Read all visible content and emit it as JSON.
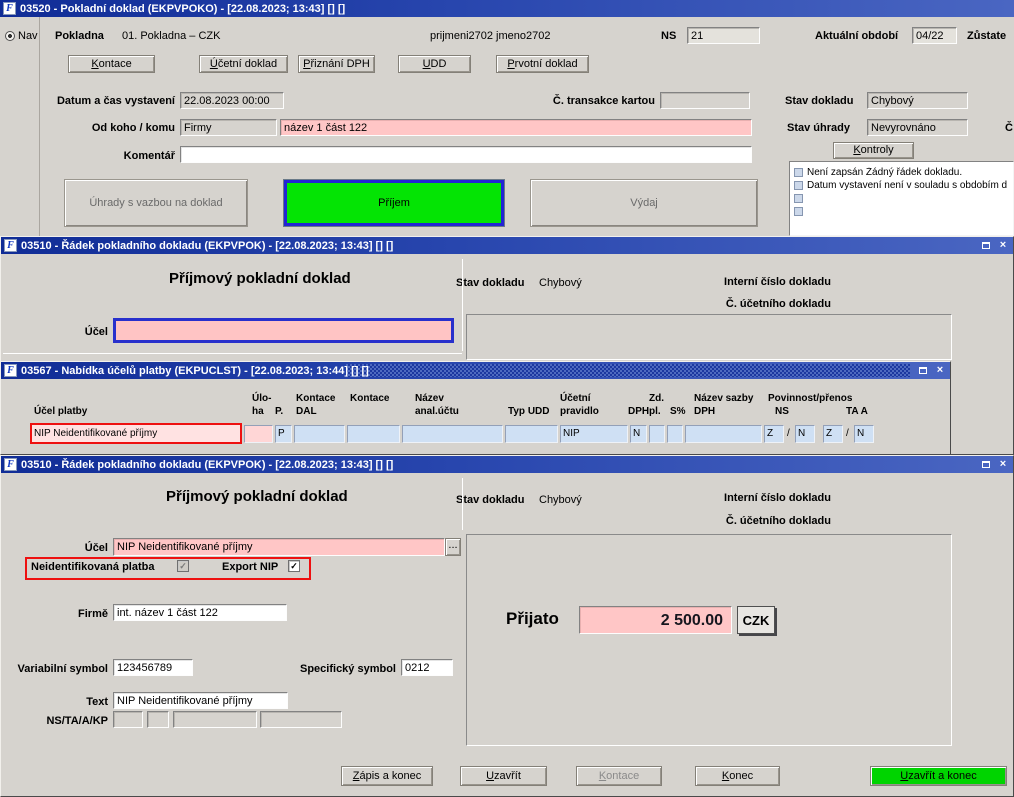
{
  "app": {
    "icon_letter": "F",
    "close_glyph": "×"
  },
  "w1": {
    "title": "03520 - Pokladní doklad (EKPVPOKO) - [22.08.2023; 13:43]  []  []",
    "nav_label": "Nav",
    "pokladna_label": "Pokladna",
    "pokladna_value": "01. Pokladna – CZK",
    "user_text": "prijmeni2702 jmeno2702",
    "ns_label": "NS",
    "ns_value": "21",
    "obdobi_label": "Aktuální období",
    "obdobi_value": "04/22",
    "zustatek_label": "Zůstate",
    "btn_kontace_u": "K",
    "btn_kontace_rest": "ontace",
    "btn_ucetni_u": "Ú",
    "btn_ucetni_rest": "četní doklad",
    "btn_priznani_u": "P",
    "btn_priznani_rest": "řiznání DPH",
    "btn_udd_u": "U",
    "btn_udd_rest": "DD",
    "btn_prvotni_u": "P",
    "btn_prvotni_rest": "rvotní doklad",
    "datum_label": "Datum a čas vystavení",
    "datum_value": "22.08.2023 00:00",
    "transakce_label": "Č. transakce kartou",
    "transakce_value": "",
    "stav_dokladu_label": "Stav dokladu",
    "stav_dokladu_value": "Chybový",
    "odkoho_label": "Od koho / komu",
    "odkoho_type_value": "Firmy",
    "odkoho_value": "název 1 část 122",
    "stav_uhrady_label": "Stav úhrady",
    "stav_uhrady_value": "Nevyrovnáno",
    "castka_label_clip": "Č",
    "komentar_label": "Komentář",
    "komentar_value": "",
    "btn_kontroly_u": "K",
    "btn_kontroly_rest": "ontroly",
    "check1": "Není zapsán Žádný řádek dokladu.",
    "check2": "Datum vystavení není v souladu s obdobím d",
    "btn_uhrady": "Úhrady s vazbou na doklad",
    "btn_prijem": "Příjem",
    "btn_vydaj": "Výdaj"
  },
  "w2": {
    "title": "03510 - Řádek pokladního dokladu (EKPVPOK) - [22.08.2023; 13:43]  []  []",
    "heading": "Příjmový pokladní doklad",
    "stav_label": "Stav dokladu",
    "stav_value": "Chybový",
    "interni_label": "Interní číslo dokladu",
    "cislo_label": "Č. účetního dokladu",
    "ucel_label": "Účel",
    "ucel_value": ""
  },
  "w3": {
    "title": "03567 - Nabídka účelů platby (EKPUCLST) - [22.08.2023; 13:44]  []  []",
    "h_ucel_platby": "Účel platby",
    "h_ulo1": "Úlo-",
    "h_ulo2": "ha",
    "h_p": "P.",
    "h_kontace1": "Kontace",
    "h_kontace1b": "DAL",
    "h_kontace2": "Kontace",
    "h_nazev1": "Název",
    "h_nazev2": "anal.účtu",
    "h_typ_udd": "Typ UDD",
    "h_ucetni1": "Účetní",
    "h_ucetni2": "pravidlo",
    "h_dph": "DPH",
    "h_zd1": "Zd.",
    "h_zd2": "pl.",
    "h_s": "S%",
    "h_sazba1": "Název sazby",
    "h_sazba2": "DPH",
    "h_povinnost": "Povinnost/přenos",
    "h_ns": "NS",
    "h_ta": "TA A",
    "slash": "/",
    "row": {
      "ucel": "NIP Neidentifikované příjmy",
      "uloha": "",
      "p": "P",
      "kontace_dal": "",
      "kontace2": "",
      "nazev": "",
      "typ_udd": "",
      "pravidlo": "NIP",
      "dph": "N",
      "zd": "",
      "s": "",
      "sazba": "",
      "ns_z": "Z",
      "ns_n": "N",
      "ta_z": "Z",
      "ta_n": "N"
    }
  },
  "w4": {
    "title": "03510 - Řádek pokladního dokladu (EKPVPOK) - [22.08.2023; 13:43]  []  []",
    "heading": "Příjmový pokladní doklad",
    "stav_label": "Stav dokladu",
    "stav_value": "Chybový",
    "interni_label": "Interní číslo dokladu",
    "cislo_label": "Č. účetního dokladu",
    "ucel_label": "Účel",
    "ucel_value": "NIP Neidentifikované příjmy",
    "ellipsis": "...",
    "nip_label": "Neidentifikovaná platba",
    "export_label": "Export NIP",
    "check_glyph": "✓",
    "firme_label": "Firmě",
    "firme_value": "int. název 1 část 122",
    "prijato_label": "Přijato",
    "prijato_value": "2 500.00",
    "mena_value": "CZK",
    "vs_label": "Variabilní symbol",
    "vs_value": "123456789",
    "ss_label": "Specifický symbol",
    "ss_value": "0212",
    "text_label": "Text",
    "text_value": "NIP Neidentifikované příjmy",
    "nstak_label": "NS/TA/A/KP",
    "btn_zapis_u": "Z",
    "btn_zapis_rest": "ápis a konec",
    "btn_uzavrit_u": "U",
    "btn_uzavrit_rest": "zavřít",
    "btn_kontace_u": "K",
    "btn_kontace_rest": "ontace",
    "btn_konec_u": "K",
    "btn_konec_rest": "onec",
    "btn_uzk_u": "U",
    "btn_uzk_rest": "zavřít a konec"
  }
}
